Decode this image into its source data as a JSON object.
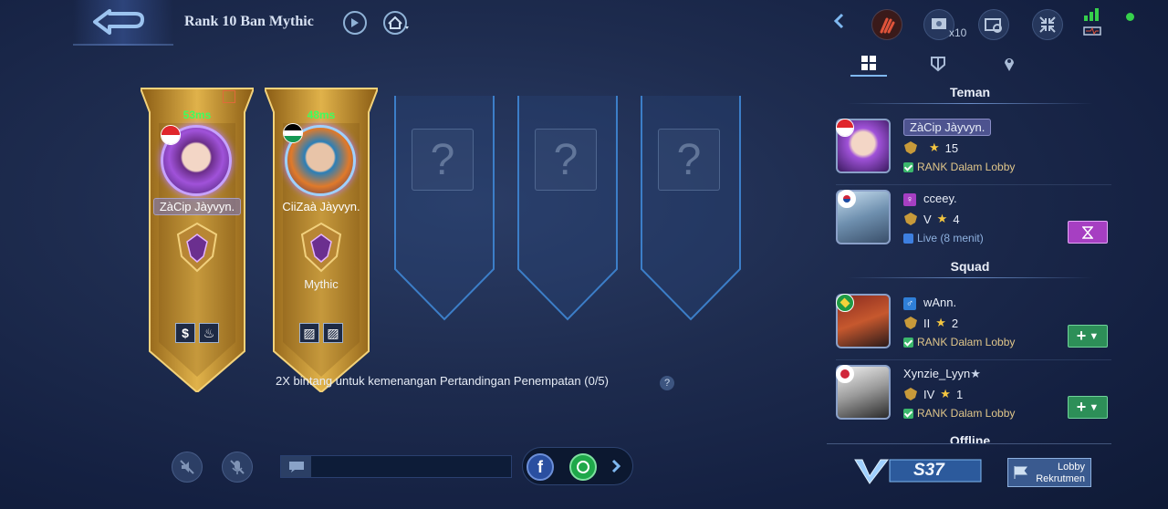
{
  "header": {
    "title": "Rank 10 Ban Mythic",
    "friend_count_badge": "x10"
  },
  "slots": [
    {
      "ping": "53ms",
      "name": "ZàCip Jàyvyn.",
      "rank_label": "",
      "filled": true
    },
    {
      "ping": "48ms",
      "name": "CiiZaà Jàyvyn.",
      "rank_label": "Mythic",
      "filled": true
    },
    {
      "filled": false,
      "placeholder": "?"
    },
    {
      "filled": false,
      "placeholder": "?"
    },
    {
      "filled": false,
      "placeholder": "?"
    }
  ],
  "bonus_text": "2X bintang untuk kemenangan Pertandingan Penempatan (0/5)",
  "help_label": "?",
  "panel": {
    "tabs": [
      "grid",
      "shield",
      "location"
    ],
    "friends_header": "Teman",
    "squad_header": "Squad",
    "offline_header": "Offline",
    "friends": [
      {
        "name": "ZàCip Jàyvyn.",
        "tier": "",
        "stars": "15",
        "status": "RANK Dalam Lobby"
      },
      {
        "name": "cceey.",
        "tier": "V",
        "stars": "4",
        "status": "Live (8 menit)"
      }
    ],
    "squad": [
      {
        "name": "wAnn.",
        "tier": "II",
        "stars": "2",
        "status": "RANK Dalam Lobby"
      },
      {
        "name": "Xynzie_Lyyn",
        "name_suffix": "★",
        "tier": "IV",
        "stars": "1",
        "status": "RANK Dalam Lobby"
      }
    ]
  },
  "season": "S37",
  "lobby_button": {
    "line1": "Lobby",
    "line2": "Rekrutmen"
  },
  "colors": {
    "gold": "#d9a93a",
    "ping": "#3dff5e",
    "online": "#36d14c",
    "add": "#2d8f58",
    "wait": "#a63fc2"
  }
}
